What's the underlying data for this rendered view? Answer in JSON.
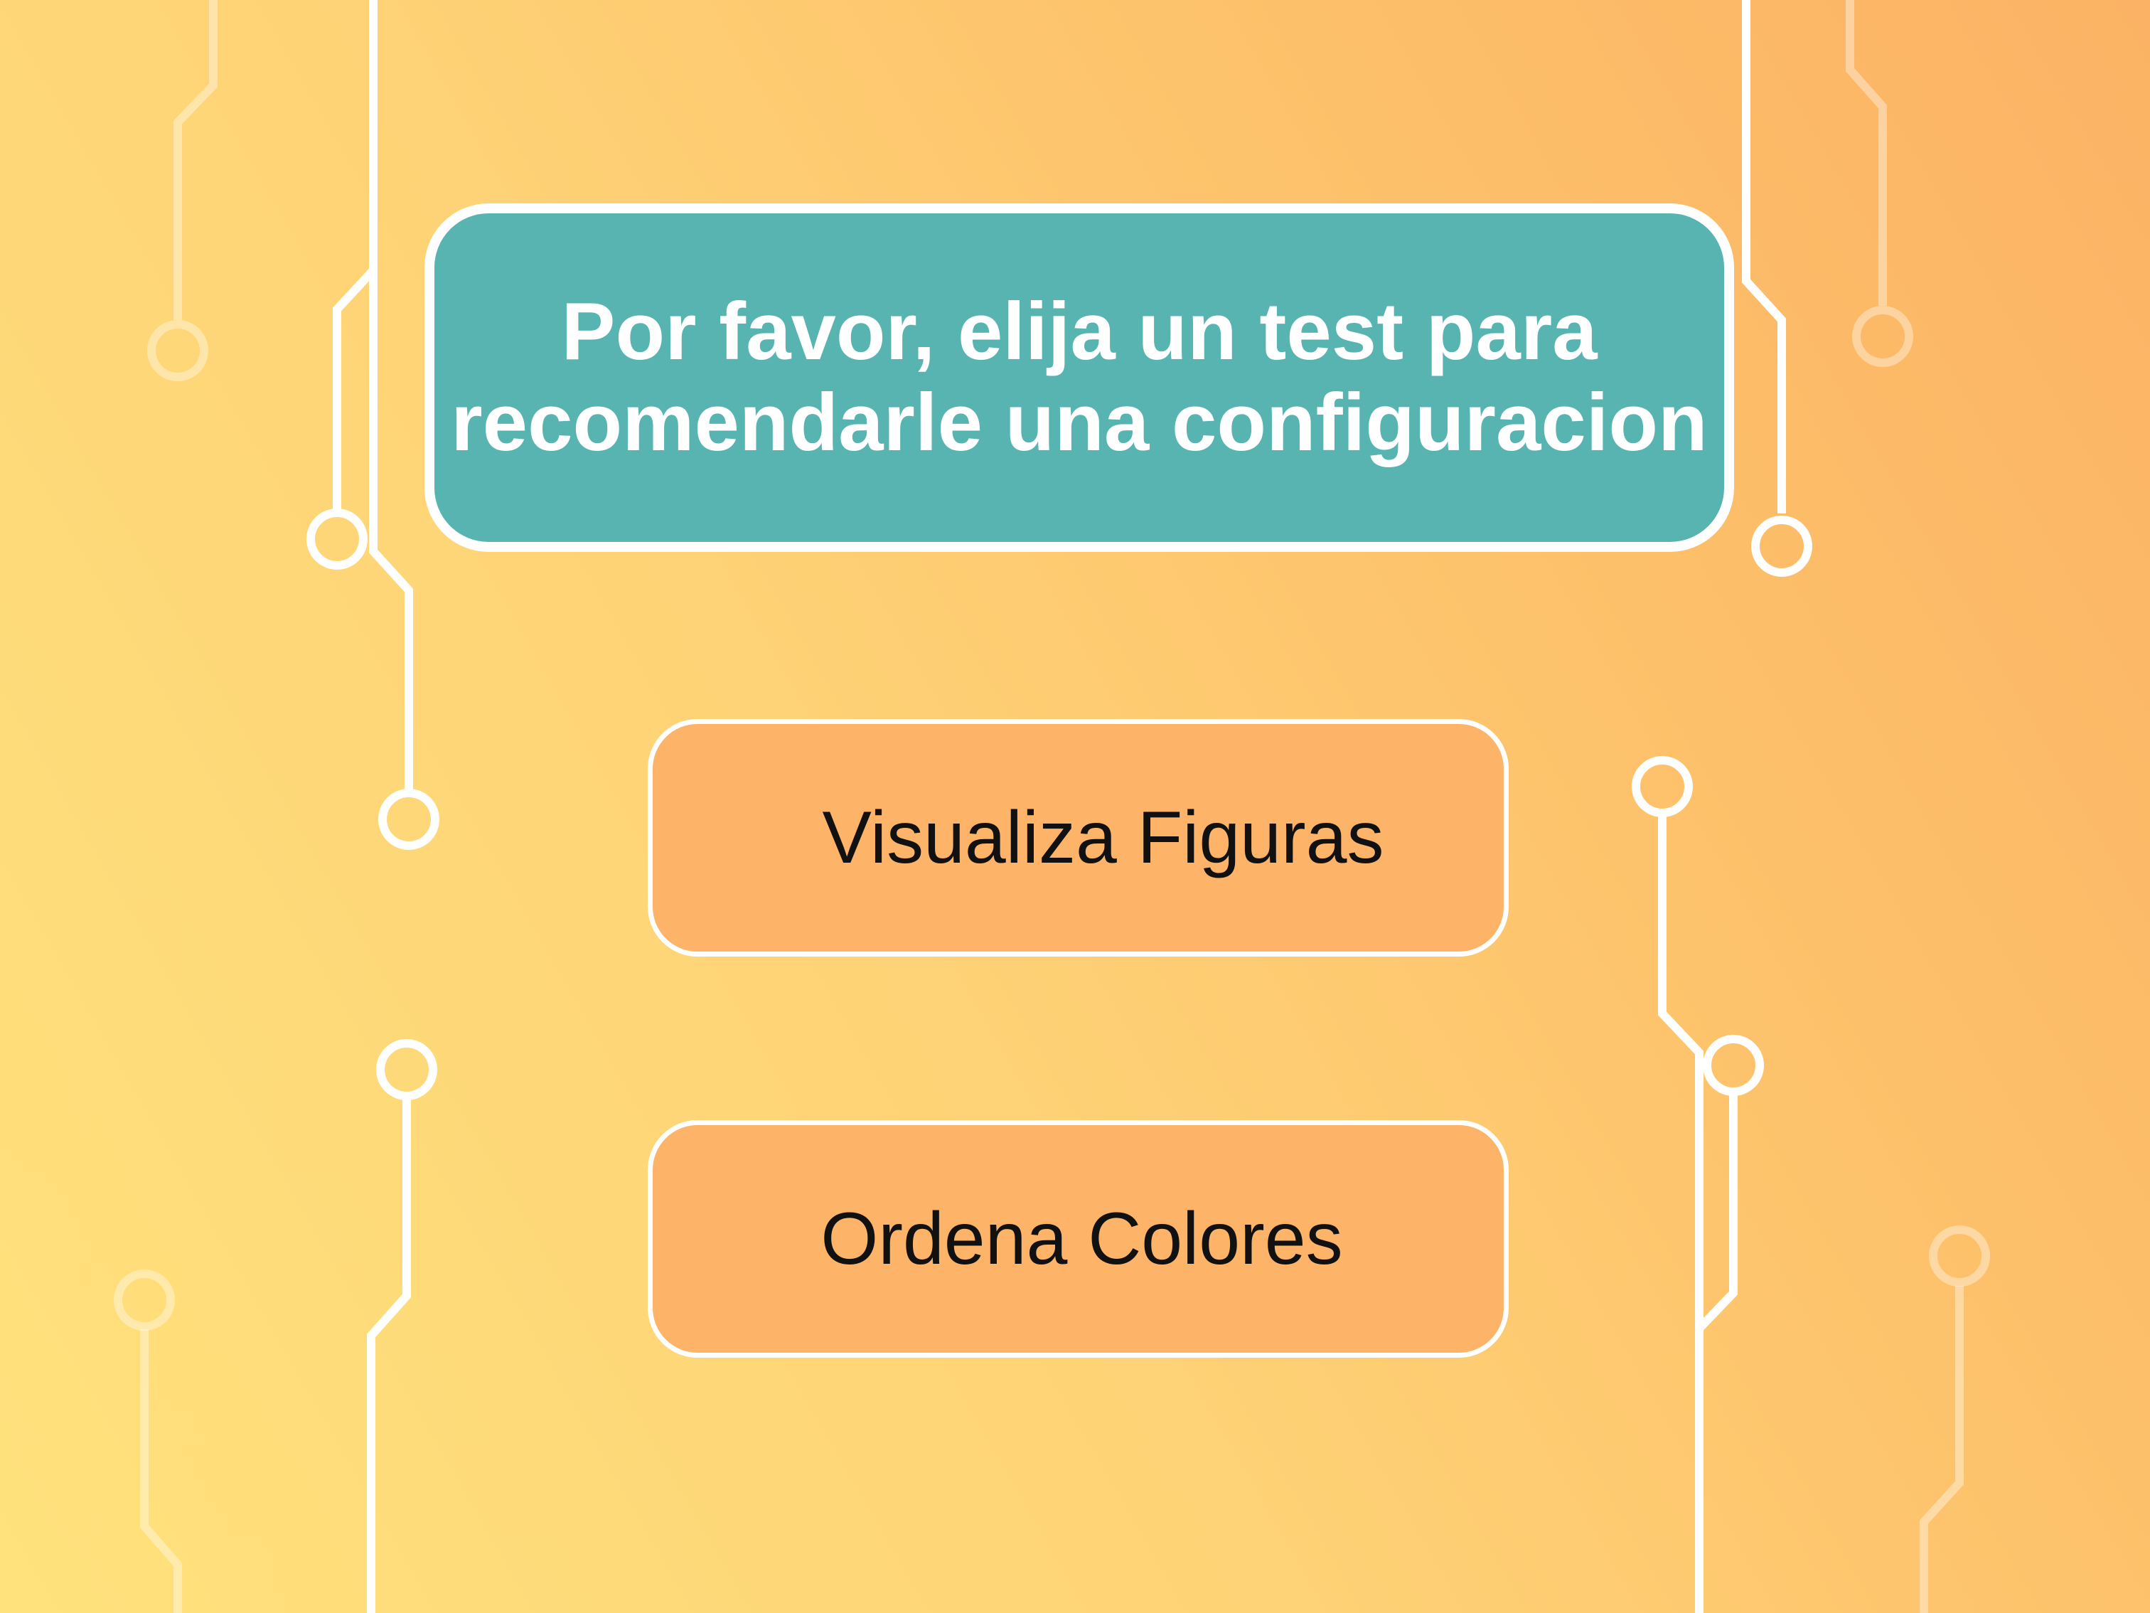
{
  "header": {
    "title_line_1": "Por favor, elija un test para",
    "title_line_2": "recomendarle una configuracion"
  },
  "options": {
    "figures_label": "Visualiza Figuras",
    "colors_label": "Ordena Colores"
  },
  "colors": {
    "title_box": "#58b4b0",
    "button_fill": "#fdb468",
    "background_start": "#ffe27c",
    "background_end": "#fbb264",
    "circuit_lines": "#ffffff"
  },
  "decorations": {
    "icon": "circuit-lines"
  }
}
